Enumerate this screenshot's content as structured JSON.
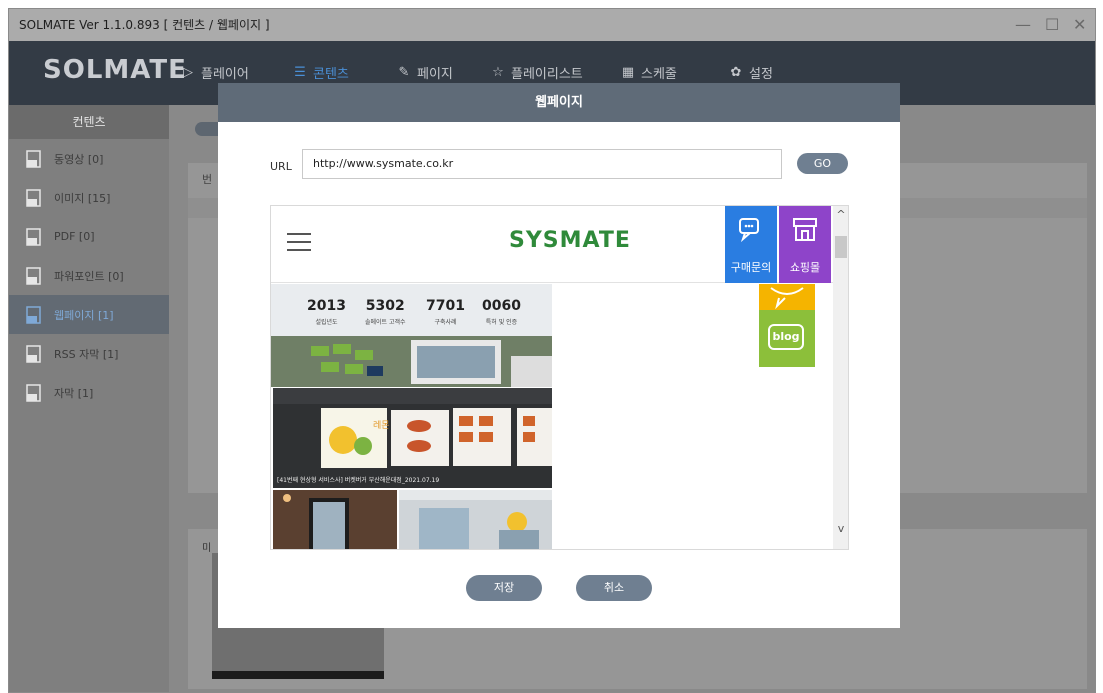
{
  "window": {
    "title": "SOLMATE Ver 1.1.0.893  [ 컨텐츠 / 웹페이지 ]",
    "minimize_glyph": "—",
    "maximize_glyph": "☐",
    "close_glyph": "✕"
  },
  "app": {
    "logo": "SOLMATE",
    "menu": [
      {
        "label": "플레이어",
        "icon": "play-icon"
      },
      {
        "label": "콘텐츠",
        "icon": "list-icon",
        "active": true
      },
      {
        "label": "페이지",
        "icon": "pin-icon"
      },
      {
        "label": "플레이리스트",
        "icon": "star-icon"
      },
      {
        "label": "스케줄",
        "icon": "calendar-icon"
      },
      {
        "label": "설정",
        "icon": "gear-icon"
      }
    ],
    "accent_color": "#4a8fd6"
  },
  "sidebar": {
    "header": "컨텐츠",
    "items": [
      {
        "label": "동영상 [0]",
        "icon": "video-file-icon"
      },
      {
        "label": "이미지 [15]",
        "icon": "image-file-icon"
      },
      {
        "label": "PDF [0]",
        "icon": "pdf-file-icon"
      },
      {
        "label": "파워포인트 [0]",
        "icon": "ppt-file-icon"
      },
      {
        "label": "웹페이지 [1]",
        "icon": "web-file-icon",
        "active": true
      },
      {
        "label": "RSS 자막 [1]",
        "icon": "rss-file-icon"
      },
      {
        "label": "자막 [1]",
        "icon": "subtitle-file-icon"
      }
    ]
  },
  "background": {
    "fragment_1": "번",
    "fragment_2": "미"
  },
  "modal": {
    "title": "웹페이지",
    "url_label": "URL",
    "url_value": "http://www.sysmate.co.kr",
    "go_label": "GO",
    "save_label": "저장",
    "cancel_label": "취소"
  },
  "preview": {
    "site_logo": "SYSMATE",
    "inquiry_label": "구매문의",
    "shop_label": "쇼핑몰",
    "blog_label": "blog",
    "scroll_up": "^",
    "scroll_down": "v",
    "stats": [
      {
        "num": "2013",
        "label": "설립년도"
      },
      {
        "num": "5302",
        "label": "솔메이트 고객수"
      },
      {
        "num": "7701",
        "label": "구축사례"
      },
      {
        "num": "0060",
        "label": "특허 및 인증"
      }
    ],
    "food_sign_text": "레몬 에이드",
    "caption": "[41번째 현상형 서비스사] 버켓버거 부산해운대점_2021.07.19",
    "inquiry_color": "#2a7de1",
    "shop_color": "#8e44c9",
    "blog_color": "#8cbf3a",
    "yellow_color": "#f5b400"
  }
}
